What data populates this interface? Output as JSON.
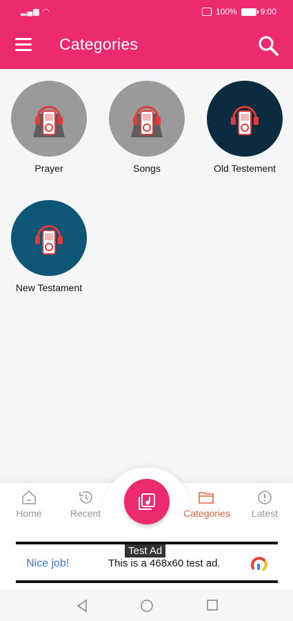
{
  "status_bar": {
    "signal_text": "ᴺᴸ ⦿",
    "battery_percent": "100%",
    "time": "9:00"
  },
  "app_bar": {
    "title": "Categories",
    "menu_icon": "hamburger-menu-icon",
    "search_icon": "search-icon"
  },
  "categories": [
    {
      "label": "Prayer",
      "style": "gray",
      "color": "#9a9a9a"
    },
    {
      "label": "Songs",
      "style": "gray",
      "color": "#9a9a9a"
    },
    {
      "label": "Old Testement",
      "style": "navy",
      "color": "#0b2b3f"
    },
    {
      "label": "New Testament",
      "style": "blue",
      "color": "#0e5675"
    }
  ],
  "bottom_nav": {
    "items": [
      {
        "label": "Home",
        "icon": "home-icon",
        "active": false
      },
      {
        "label": "Recent",
        "icon": "history-icon",
        "active": false
      },
      {
        "label": "Categories",
        "icon": "folder-icon",
        "active": true
      },
      {
        "label": "Latest",
        "icon": "alert-circle-icon",
        "active": false
      }
    ],
    "fab_icon": "music-library-icon"
  },
  "ad": {
    "tag": "Test Ad",
    "headline": "Nice job!",
    "text": "This is a 468x60 test ad."
  },
  "colors": {
    "primary": "#ee2a6f",
    "active_nav": "#e0643a",
    "inactive_nav": "#9a9a9a"
  }
}
